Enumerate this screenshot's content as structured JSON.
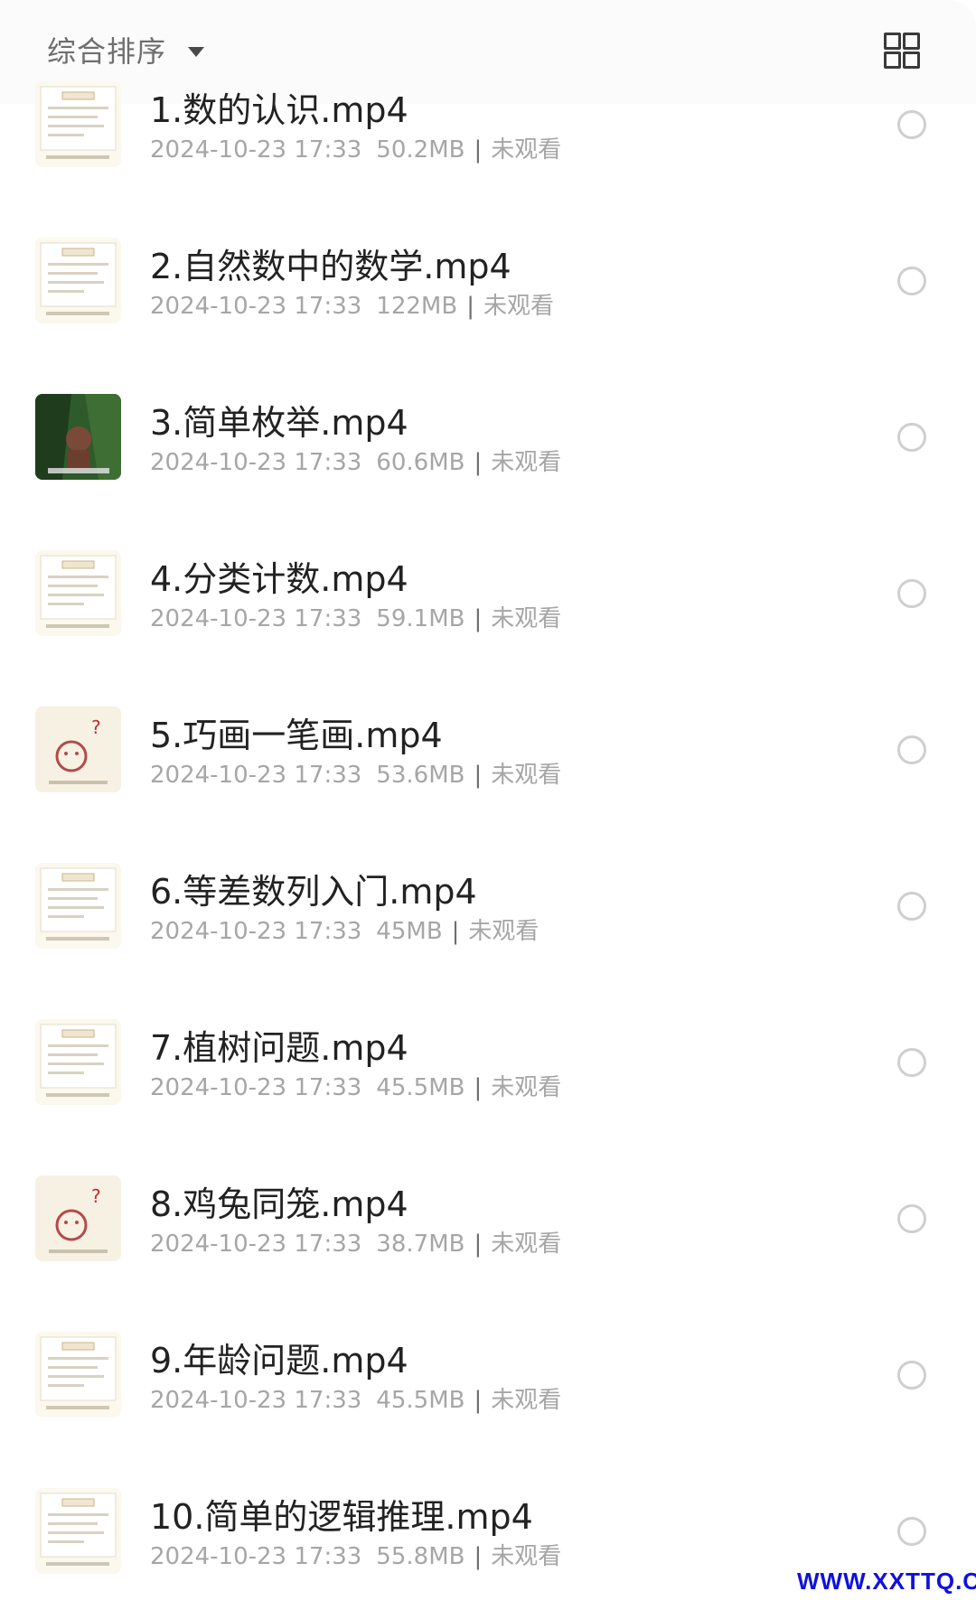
{
  "header": {
    "sort_label": "综合排序",
    "sort_icon": "caret-down-icon",
    "view_toggle_icon": "grid-view-icon"
  },
  "files": [
    {
      "title": "1.数的认识.mp4",
      "date": "2024-10-23 17:33",
      "size": "50.2MB",
      "status": "未观看",
      "thumb_style": "slide"
    },
    {
      "title": "2.自然数中的数学.mp4",
      "date": "2024-10-23 17:33",
      "size": "122MB",
      "status": "未观看",
      "thumb_style": "slide"
    },
    {
      "title": "3.简单枚举.mp4",
      "date": "2024-10-23 17:33",
      "size": "60.6MB",
      "status": "未观看",
      "thumb_style": "dark"
    },
    {
      "title": "4.分类计数.mp4",
      "date": "2024-10-23 17:33",
      "size": "59.1MB",
      "status": "未观看",
      "thumb_style": "slide"
    },
    {
      "title": "5.巧画一笔画.mp4",
      "date": "2024-10-23 17:33",
      "size": "53.6MB",
      "status": "未观看",
      "thumb_style": "cartoon"
    },
    {
      "title": "6.等差数列入门.mp4",
      "date": "2024-10-23 17:33",
      "size": "45MB",
      "status": "未观看",
      "thumb_style": "slide"
    },
    {
      "title": "7.植树问题.mp4",
      "date": "2024-10-23 17:33",
      "size": "45.5MB",
      "status": "未观看",
      "thumb_style": "slide"
    },
    {
      "title": "8.鸡兔同笼.mp4",
      "date": "2024-10-23 17:33",
      "size": "38.7MB",
      "status": "未观看",
      "thumb_style": "cartoon"
    },
    {
      "title": "9.年龄问题.mp4",
      "date": "2024-10-23 17:33",
      "size": "45.5MB",
      "status": "未观看",
      "thumb_style": "slide"
    },
    {
      "title": "10.简单的逻辑推理.mp4",
      "date": "2024-10-23 17:33",
      "size": "55.8MB",
      "status": "未观看",
      "thumb_style": "slide"
    }
  ],
  "watermark": "WWW.XXTTQ.COM",
  "colors": {
    "title": "#222222",
    "meta": "#a6a6a6",
    "watermark": "#1010e0"
  }
}
